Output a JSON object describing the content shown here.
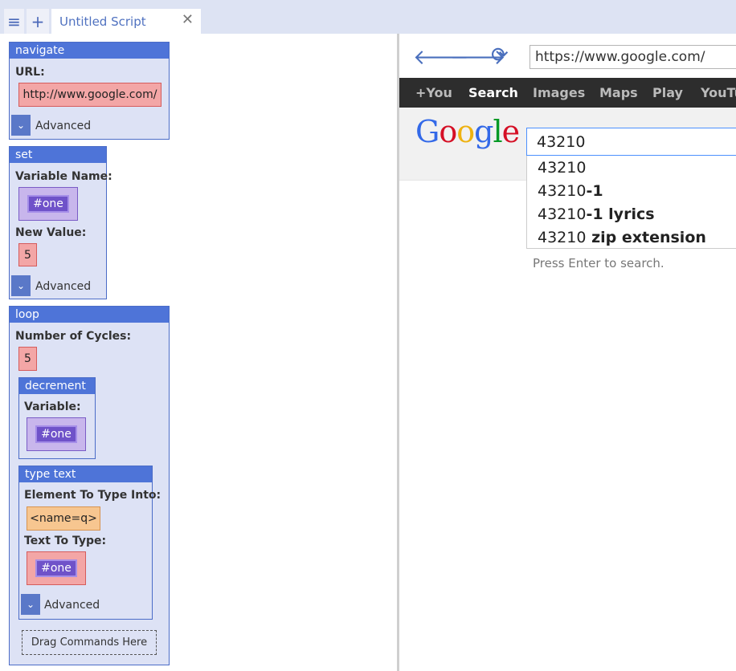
{
  "tabbar": {
    "menu_icon": "hamburger-icon",
    "add_icon": "plus-icon",
    "tab_title": "Untitled Script",
    "close_icon": "close-icon"
  },
  "commands": {
    "navigate": {
      "title": "navigate",
      "url_label": "URL:",
      "url_value": "http://www.google.com/",
      "advanced_label": "Advanced"
    },
    "set": {
      "title": "set",
      "var_label": "Variable Name:",
      "var_value": "#one",
      "new_value_label": "New Value:",
      "new_value": "5",
      "advanced_label": "Advanced"
    },
    "loop": {
      "title": "loop",
      "cycles_label": "Number of Cycles:",
      "cycles_value": "5",
      "decrement": {
        "title": "decrement",
        "var_label": "Variable:",
        "var_value": "#one"
      },
      "type_text": {
        "title": "type text",
        "element_label": "Element To Type Into:",
        "element_value": "<name=q>",
        "text_label": "Text To Type:",
        "text_value": "#one",
        "advanced_label": "Advanced"
      },
      "drop_label": "Drag Commands Here"
    }
  },
  "browser": {
    "back_icon": "arrow-left-icon",
    "forward_icon": "arrow-right-icon",
    "reload_icon": "reload-icon",
    "url": "https://www.google.com/",
    "gbar": [
      "+You",
      "Search",
      "Images",
      "Maps",
      "Play",
      "YouTu"
    ],
    "gbar_active": "Search",
    "logo": [
      "G",
      "o",
      "o",
      "g",
      "l",
      "e"
    ],
    "logo_colors": [
      "#3369e8",
      "#d50f25",
      "#eeb211",
      "#3369e8",
      "#009925",
      "#d50f25"
    ],
    "search_value": "43210",
    "suggestions": [
      {
        "prefix": "43210",
        "suffix": ""
      },
      {
        "prefix": "43210",
        "suffix": "-1"
      },
      {
        "prefix": "43210",
        "suffix": "-1 lyrics"
      },
      {
        "prefix": "43210",
        "suffix": " zip extension"
      }
    ],
    "hint": "Press Enter to search."
  }
}
